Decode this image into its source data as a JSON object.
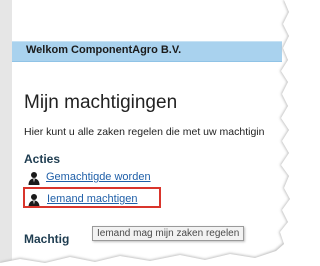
{
  "header": {
    "title": "Welkom ComponentAgro B.V."
  },
  "main": {
    "title": "Mijn machtigingen",
    "intro": "Hier kunt u alle zaken regelen die met uw machtigin"
  },
  "actions": {
    "heading": "Acties",
    "items": [
      {
        "label": "Gemachtigde worden",
        "icon": "person-icon"
      },
      {
        "label": "Iemand machtigen",
        "icon": "person-icon"
      }
    ]
  },
  "tooltip": {
    "text": "Iemand mag mijn zaken regelen"
  },
  "section2": {
    "heading": "Machtig"
  },
  "colors": {
    "header_bg": "#a9d2ee",
    "link": "#1f5fa8",
    "highlight": "#d9352c"
  }
}
